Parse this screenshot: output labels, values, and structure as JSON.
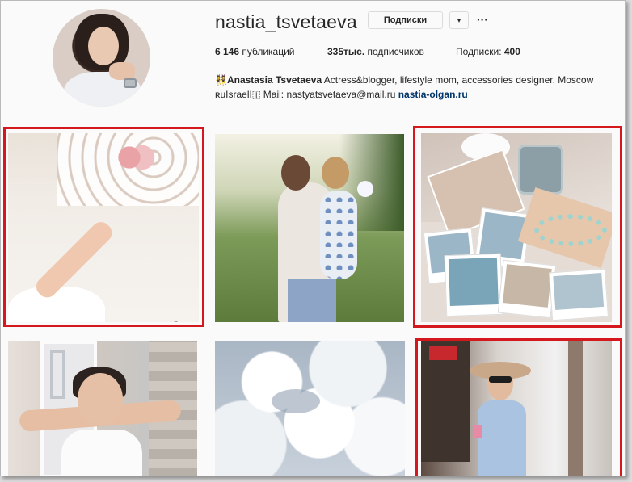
{
  "profile": {
    "username": "nastia_tsvetaeva",
    "follow_button": "Подписки",
    "dropdown_glyph": "▾",
    "more_glyph": "···",
    "stats": {
      "posts_count": "6 146",
      "posts_label": "публикаций",
      "followers_count": "335тыс.",
      "followers_label": "подписчиков",
      "following_label": "Подписки:",
      "following_count": "400"
    },
    "bio": {
      "name": "👯Anastasia Tsvetaeva",
      "text1": " Actress&blogger, lifestyle mom, accessories designer. Moscow",
      "text2": "ʀuIsraelI🇮 Mail: nastyatsvetaeva@mail.ru ",
      "link": "nastia-olgan.ru"
    }
  },
  "grid": {
    "highlight_color": "#d4181e",
    "posts": [
      {
        "id": "post-1",
        "highlighted": true
      },
      {
        "id": "post-2",
        "highlighted": false
      },
      {
        "id": "post-3",
        "highlighted": true
      },
      {
        "id": "post-4",
        "highlighted": false
      },
      {
        "id": "post-5",
        "highlighted": false
      },
      {
        "id": "post-6",
        "highlighted": true
      }
    ]
  }
}
